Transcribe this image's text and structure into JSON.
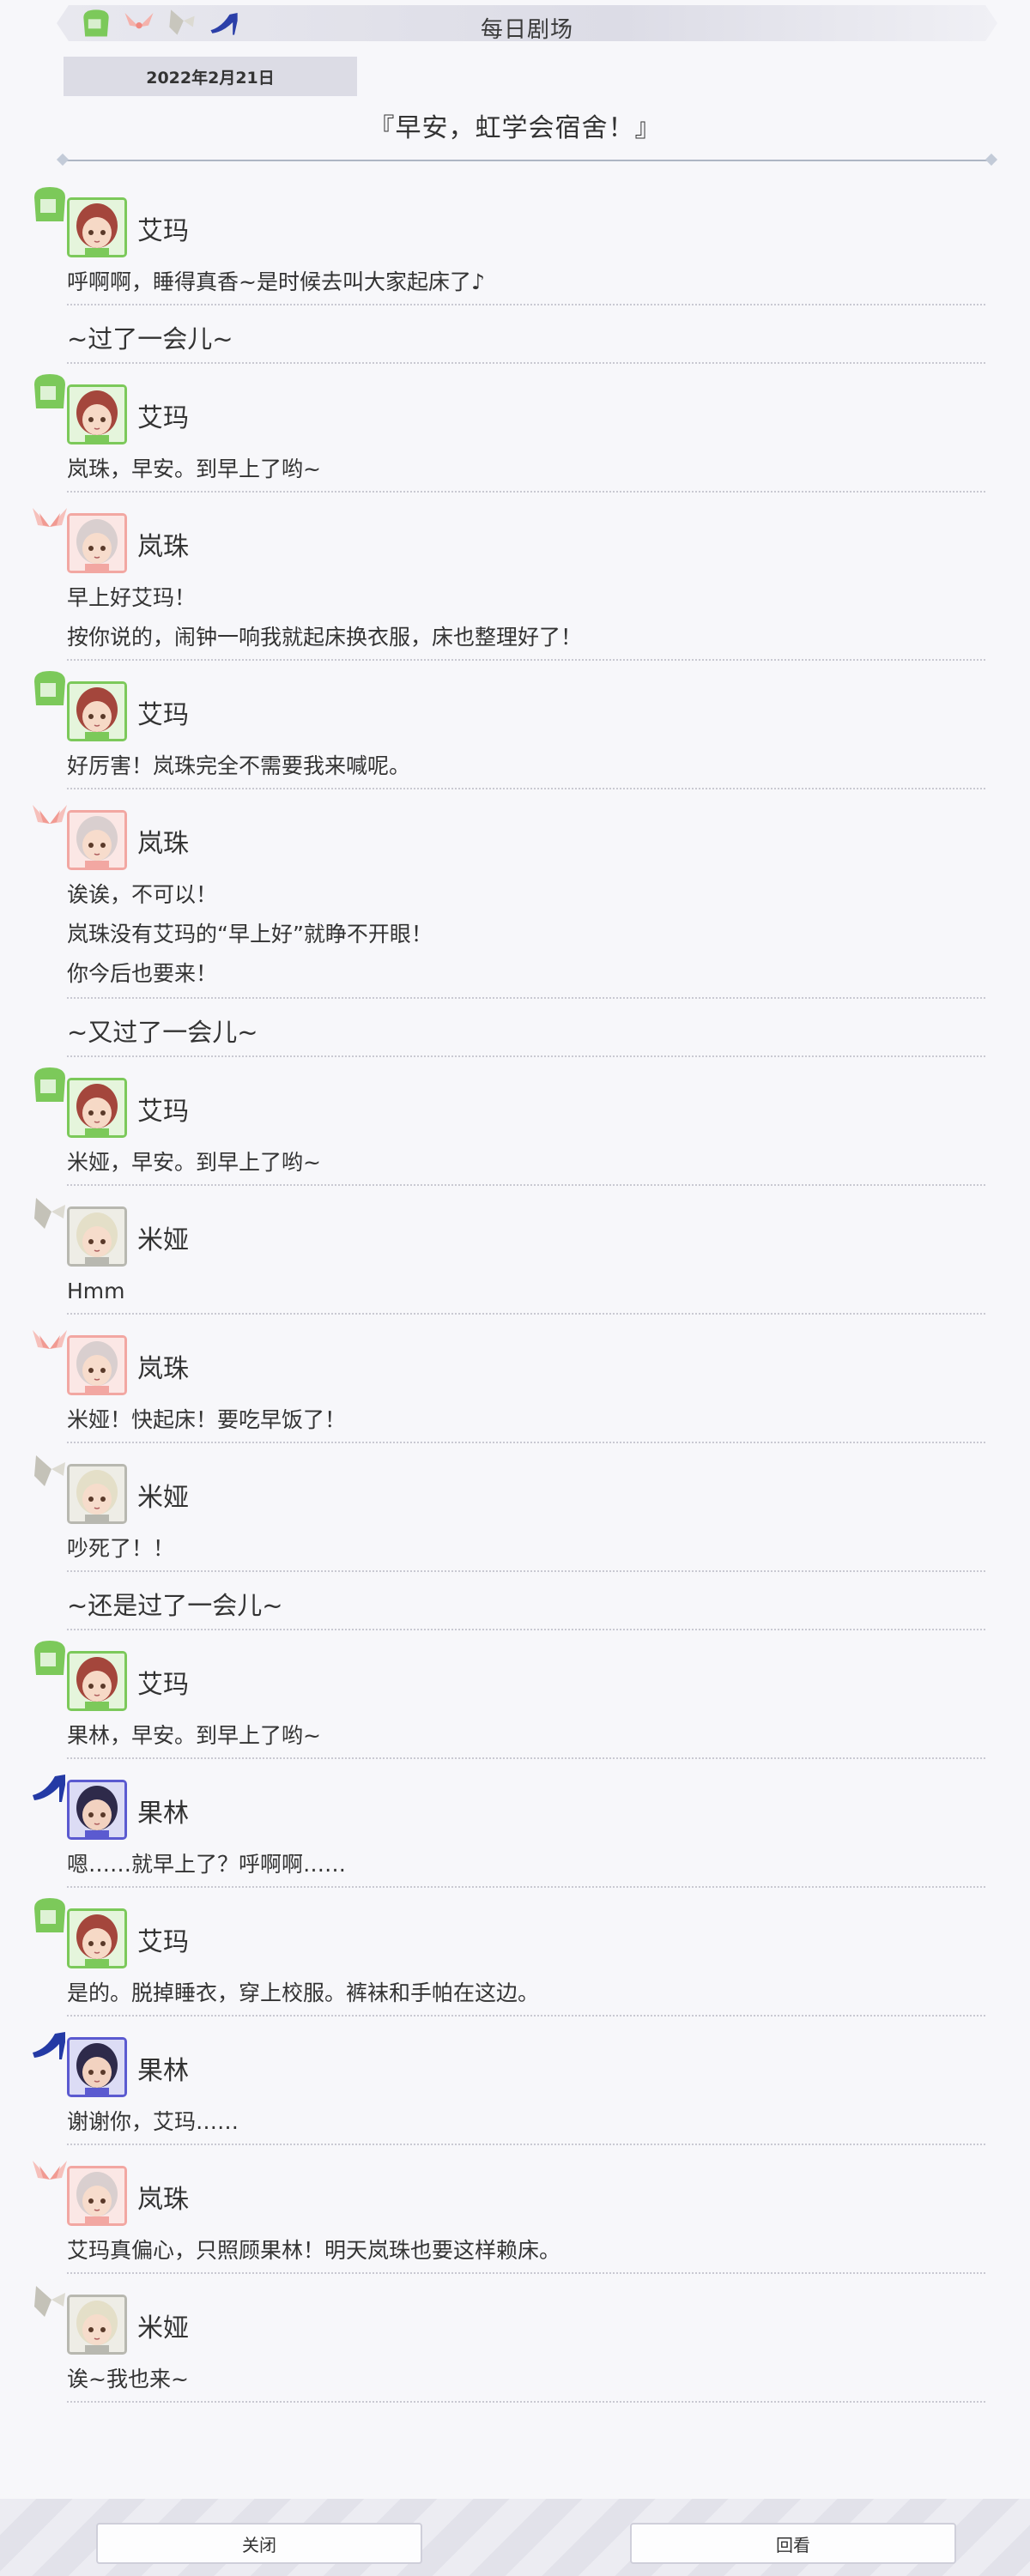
{
  "header": {
    "title": "每日剧场",
    "icons": [
      "bread-icon",
      "wings-icon",
      "ribbon-icon",
      "high-heel-icon"
    ]
  },
  "date": "2022年2月21日",
  "story_title": "『早安，虹学会宿舍！』",
  "characters": {
    "ema": {
      "name": "艾玛",
      "badge": "bread-icon",
      "accent": "#7cc95a",
      "hair": "#a4463c",
      "skin": "#f6d9c6",
      "bg": "#e5f5dc"
    },
    "lanzhu": {
      "name": "岚珠",
      "badge": "wings-icon",
      "accent": "#f2a7a2",
      "hair": "#d9cfcf",
      "skin": "#f7dccc",
      "bg": "#fbe7e5"
    },
    "mia": {
      "name": "米娅",
      "badge": "ribbon-icon",
      "accent": "#b8b8b0",
      "hair": "#e4dfc8",
      "skin": "#f6dccb",
      "bg": "#eeede6"
    },
    "guolin": {
      "name": "果林",
      "badge": "high-heel-icon",
      "accent": "#5b5ad0",
      "hair": "#2e2a4a",
      "skin": "#f2d2c0",
      "bg": "#dcdcf5"
    }
  },
  "entries": [
    {
      "type": "dialog",
      "char": "ema",
      "lines": [
        "呼啊啊，睡得真香~是时候去叫大家起床了♪"
      ]
    },
    {
      "type": "narration",
      "text": "~过了一会儿~"
    },
    {
      "type": "dialog",
      "char": "ema",
      "lines": [
        "岚珠，早安。到早上了哟~"
      ]
    },
    {
      "type": "dialog",
      "char": "lanzhu",
      "lines": [
        "早上好艾玛！",
        "按你说的，闹钟一响我就起床换衣服，床也整理好了！"
      ]
    },
    {
      "type": "dialog",
      "char": "ema",
      "lines": [
        "好厉害！岚珠完全不需要我来喊呢。"
      ]
    },
    {
      "type": "dialog",
      "char": "lanzhu",
      "lines": [
        "诶诶，不可以！",
        "岚珠没有艾玛的“早上好”就睁不开眼！",
        "你今后也要来！"
      ]
    },
    {
      "type": "narration",
      "text": "~又过了一会儿~"
    },
    {
      "type": "dialog",
      "char": "ema",
      "lines": [
        "米娅，早安。到早上了哟~"
      ]
    },
    {
      "type": "dialog",
      "char": "mia",
      "lines": [
        "Hmm"
      ]
    },
    {
      "type": "dialog",
      "char": "lanzhu",
      "lines": [
        "米娅！快起床！要吃早饭了！"
      ]
    },
    {
      "type": "dialog",
      "char": "mia",
      "lines": [
        "吵死了！！"
      ]
    },
    {
      "type": "narration",
      "text": "~还是过了一会儿~"
    },
    {
      "type": "dialog",
      "char": "ema",
      "lines": [
        "果林，早安。到早上了哟~"
      ]
    },
    {
      "type": "dialog",
      "char": "guolin",
      "lines": [
        "嗯……就早上了？呼啊啊……"
      ]
    },
    {
      "type": "dialog",
      "char": "ema",
      "lines": [
        "是的。脱掉睡衣，穿上校服。裤袜和手帕在这边。"
      ]
    },
    {
      "type": "dialog",
      "char": "guolin",
      "lines": [
        "谢谢你，艾玛……"
      ]
    },
    {
      "type": "dialog",
      "char": "lanzhu",
      "lines": [
        "艾玛真偏心，只照顾果林！明天岚珠也要这样赖床。"
      ]
    },
    {
      "type": "dialog",
      "char": "mia",
      "lines": [
        "诶~我也来~"
      ]
    }
  ],
  "footer": {
    "close_label": "关闭",
    "review_label": "回看"
  }
}
